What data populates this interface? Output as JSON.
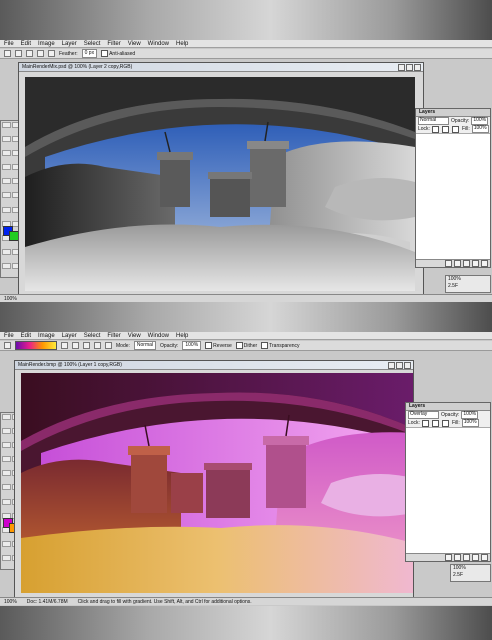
{
  "menus": [
    "File",
    "Edit",
    "Image",
    "Layer",
    "Select",
    "Filter",
    "View",
    "Window",
    "Help"
  ],
  "top": {
    "options": {
      "feather_label": "Feather:",
      "feather_value": "0 px",
      "antialiased_label": "Anti-aliased"
    },
    "document_title": "MainRenderMix.psd @ 100% (Layer 2 copy,RGB)",
    "layers_panel": {
      "title": "Layers",
      "blend_mode": "Normal",
      "opacity_label": "Opacity:",
      "opacity_value": "100%",
      "lock_label": "Lock:",
      "fill_label": "Fill:",
      "fill_value": "100%"
    },
    "mini_panel": [
      "100%",
      "2.5F"
    ],
    "status": [
      "100%"
    ],
    "colors": {
      "foreground": "#0022ee",
      "background": "#22cc22"
    }
  },
  "bottom": {
    "options": {
      "mode_label": "Mode:",
      "mode_value": "Normal",
      "opacity_label": "Opacity:",
      "opacity_value": "100%",
      "reverse_label": "Reverse",
      "dither_label": "Dither",
      "transparency_label": "Transparency"
    },
    "document_title": "MainRender.bmp @ 100% (Layer 1 copy,RGB)",
    "layers_panel": {
      "title": "Layers",
      "blend_mode": "Overlay",
      "opacity_label": "Opacity:",
      "opacity_value": "100%",
      "lock_label": "Lock:",
      "fill_label": "Fill:",
      "fill_value": "100%"
    },
    "mini_panel": [
      "100%",
      "2.5F"
    ],
    "status": [
      "100%",
      "Doc: 1.41M/6.78M",
      "Click and drag to fill with gradient. Use Shift, Alt, and Ctrl for additional options."
    ],
    "colors": {
      "foreground": "#cc00cc",
      "background": "#ff9900"
    }
  }
}
